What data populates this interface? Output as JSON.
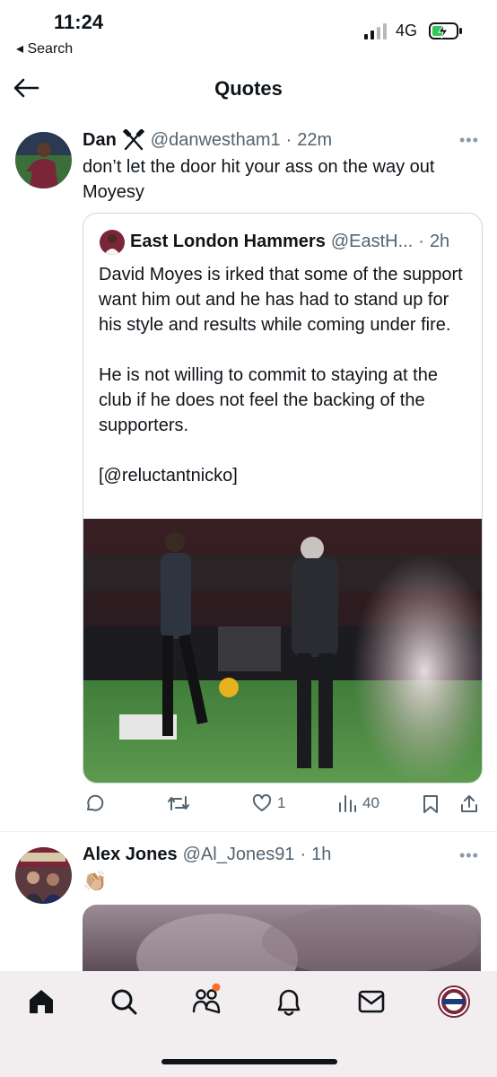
{
  "status": {
    "time": "11:24",
    "back_label": "◂ Search",
    "network": "4G"
  },
  "header": {
    "title": "Quotes"
  },
  "tweet1": {
    "name": "Dan",
    "name_icon": "hammers-icon",
    "handle": "@danwestham1",
    "time": "22m",
    "text": "don’t let the door hit your ass on the way out Moyesy",
    "quote": {
      "name": "East London Hammers",
      "handle": "@EastH...",
      "time": "2h",
      "text": "David Moyes is irked that some of the support want him out and he has had to stand up for his style and results while coming under fire.\n\nHe is not willing to commit to staying at the club if he does not feel the backing of the supporters.\n\n[@reluctantnicko]"
    },
    "actions": {
      "replies": "",
      "retweets": "",
      "likes": "1",
      "views": "40"
    }
  },
  "tweet2": {
    "name": "Alex Jones",
    "handle": "@Al_Jones91",
    "time": "1h",
    "text": "👏🏼"
  },
  "tabbar": {
    "items": [
      "home-icon",
      "search-icon",
      "communities-icon",
      "notifications-icon",
      "messages-icon",
      "profile-avatar"
    ]
  },
  "colors": {
    "text": "#0f1419",
    "secondary": "#536471",
    "accent_dot": "#f4712a",
    "claret": "#7a2638"
  }
}
